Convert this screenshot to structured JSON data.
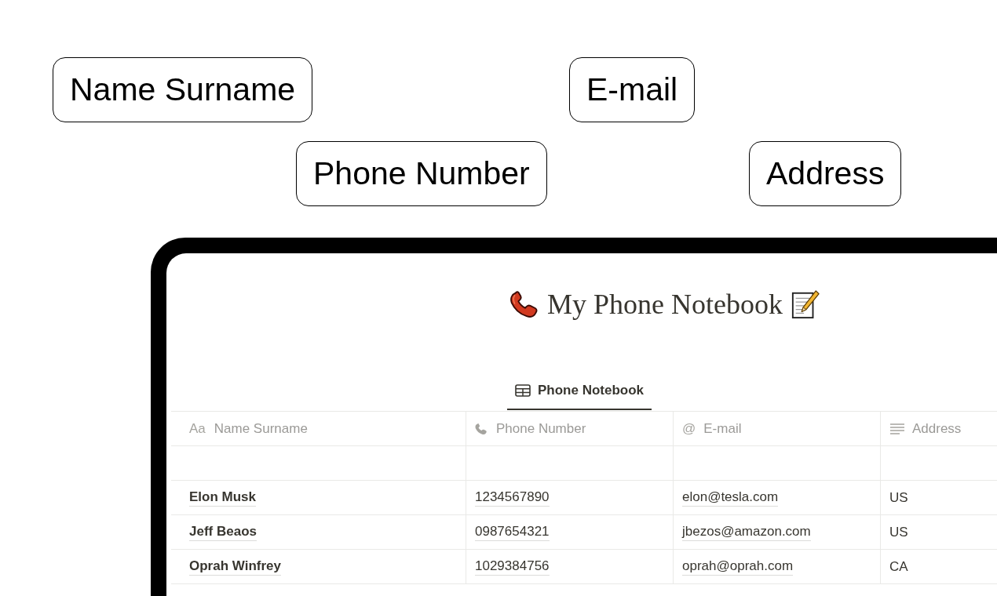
{
  "annotations": [
    {
      "label": "Name Surname"
    },
    {
      "label": "E-mail"
    },
    {
      "label": "Phone Number"
    },
    {
      "label": "Address"
    }
  ],
  "page": {
    "title": "My Phone Notebook",
    "tabs": [
      {
        "label": "Phone Notebook",
        "selected": true
      }
    ],
    "table": {
      "columns": [
        {
          "kind": "title",
          "icon": "Aa",
          "label": "Name Surname"
        },
        {
          "kind": "phone",
          "label": "Phone Number"
        },
        {
          "kind": "email",
          "icon": "@",
          "label": "E-mail"
        },
        {
          "kind": "text",
          "label": "Address"
        }
      ],
      "rows": [
        [
          "Elon Musk",
          "1234567890",
          "elon@tesla.com",
          "US"
        ],
        [
          "Jeff Beaos",
          "0987654321",
          "jbezos@amazon.com",
          "US"
        ],
        [
          "Oprah Winfrey",
          "1029384756",
          "oprah@oprah.com",
          "CA"
        ]
      ]
    }
  }
}
